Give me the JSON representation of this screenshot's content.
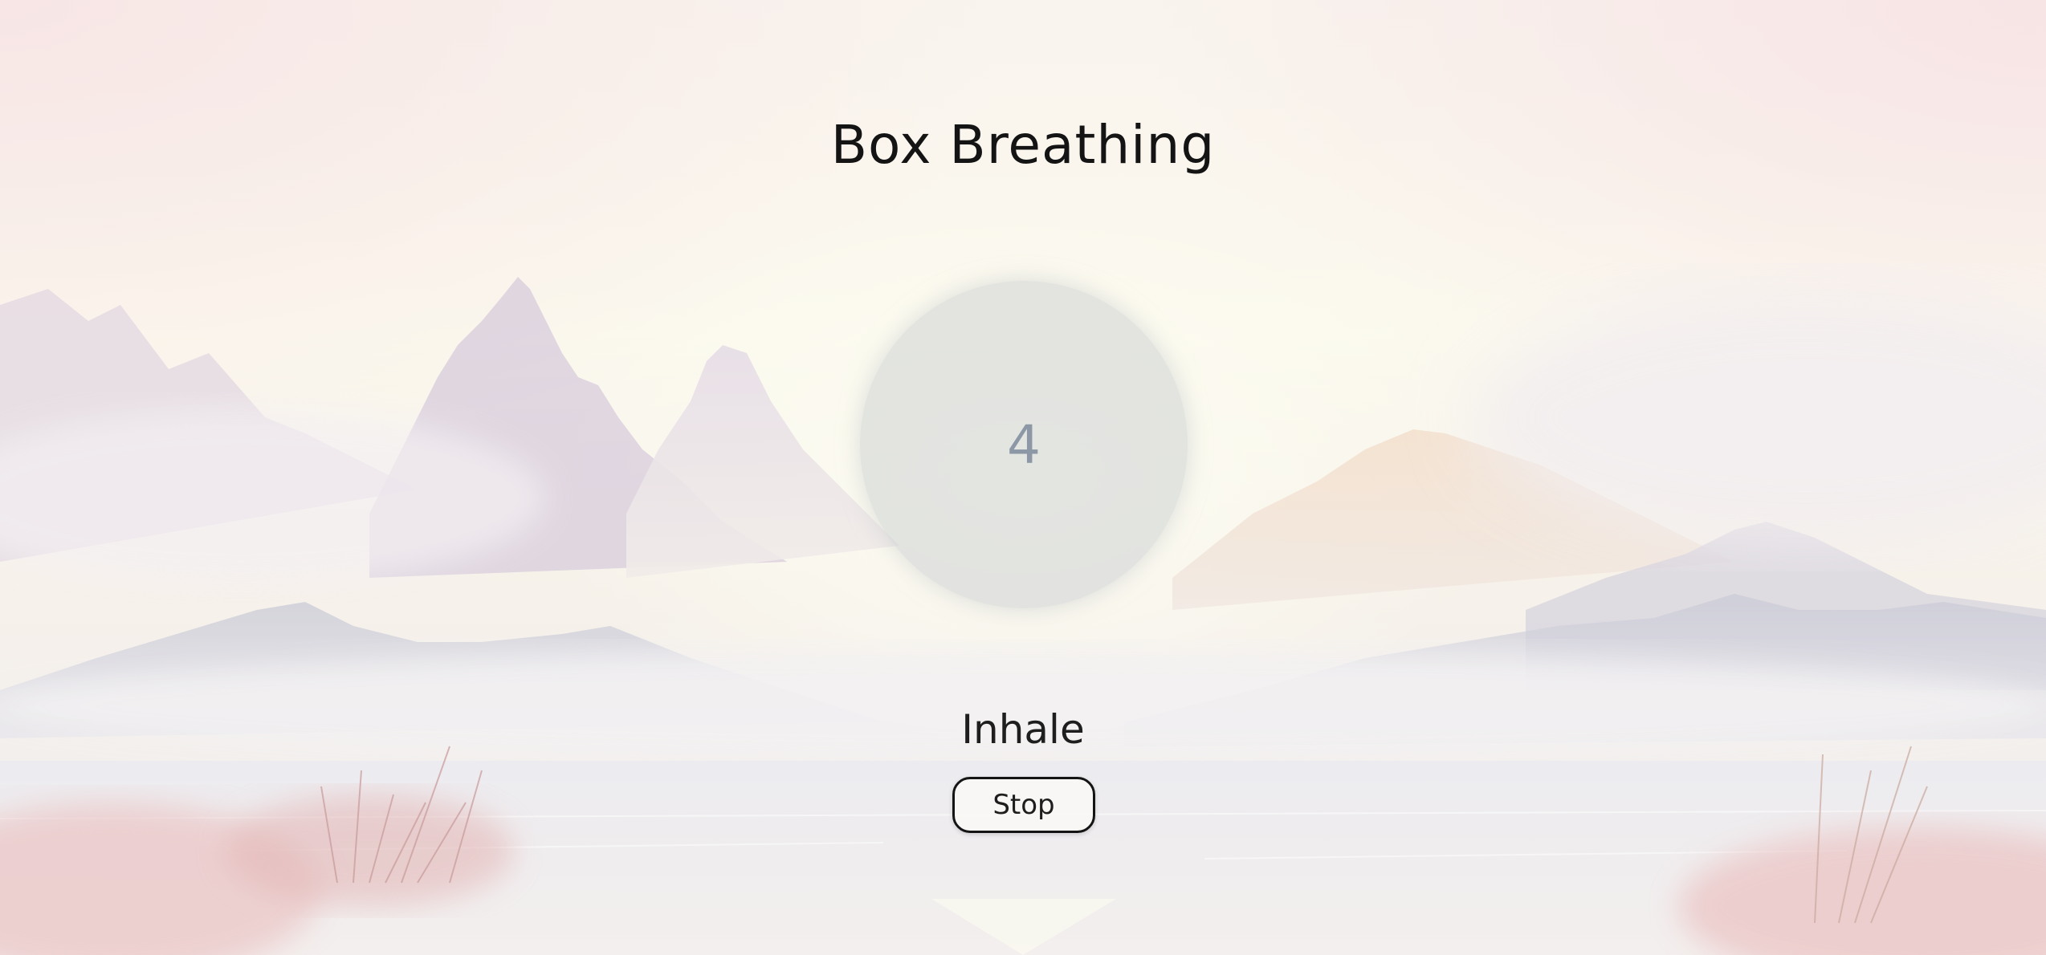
{
  "app": {
    "title": "Box Breathing"
  },
  "breath": {
    "count": "4",
    "phase": "Inhale"
  },
  "controls": {
    "stop_label": "Stop"
  },
  "colors": {
    "text": "#141414",
    "circle": "#ced2d4",
    "count": "#8c98a6",
    "sky": "#fbf8ec",
    "mountain": "#d8d4dc",
    "foliage": "#e6bcbc"
  }
}
